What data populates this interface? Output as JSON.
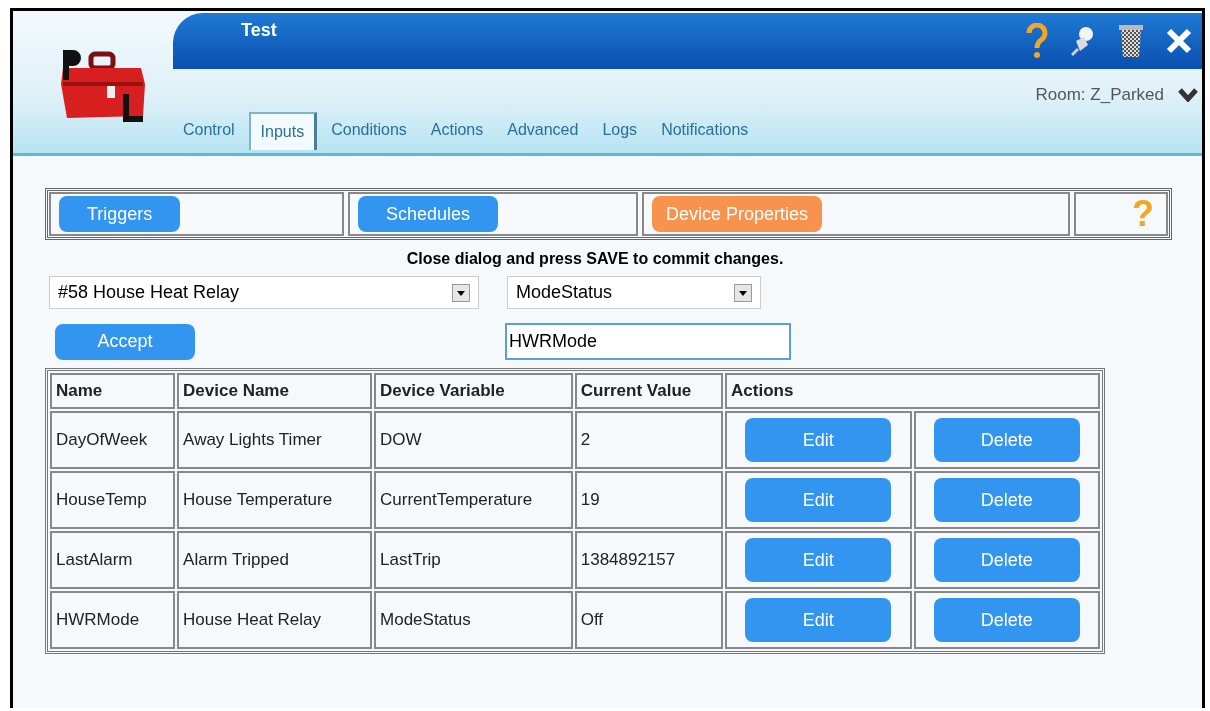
{
  "window": {
    "title": "Test"
  },
  "room": {
    "label": "Room: Z_Parked"
  },
  "tabs": [
    {
      "label": "Control",
      "selected": false
    },
    {
      "label": "Inputs",
      "selected": true
    },
    {
      "label": "Conditions",
      "selected": false
    },
    {
      "label": "Actions",
      "selected": false
    },
    {
      "label": "Advanced",
      "selected": false
    },
    {
      "label": "Logs",
      "selected": false
    },
    {
      "label": "Notifications",
      "selected": false
    }
  ],
  "subtabs": [
    {
      "label": "Triggers",
      "selected": false
    },
    {
      "label": "Schedules",
      "selected": false
    },
    {
      "label": "Device Properties",
      "selected": true
    }
  ],
  "help_mark": "?",
  "message": "Close dialog and press SAVE to commit changes.",
  "device_select": {
    "value": "#58 House Heat Relay"
  },
  "variable_select": {
    "value": "ModeStatus"
  },
  "accept_button": "Accept",
  "name_field": {
    "value": "HWRMode"
  },
  "table": {
    "columns": [
      "Name",
      "Device Name",
      "Device Variable",
      "Current Value",
      "Actions"
    ],
    "rows": [
      {
        "cells": [
          "DayOfWeek",
          "Away Lights Timer",
          "DOW",
          "2"
        ],
        "edit": "Edit",
        "delete": "Delete"
      },
      {
        "cells": [
          "HouseTemp",
          "House Temperature",
          "CurrentTemperature",
          "19"
        ],
        "edit": "Edit",
        "delete": "Delete"
      },
      {
        "cells": [
          "LastAlarm",
          "Alarm Tripped",
          "LastTrip",
          "1384892157"
        ],
        "edit": "Edit",
        "delete": "Delete"
      },
      {
        "cells": [
          "HWRMode",
          "House Heat Relay",
          "ModeStatus",
          "Off"
        ],
        "edit": "Edit",
        "delete": "Delete"
      }
    ]
  }
}
